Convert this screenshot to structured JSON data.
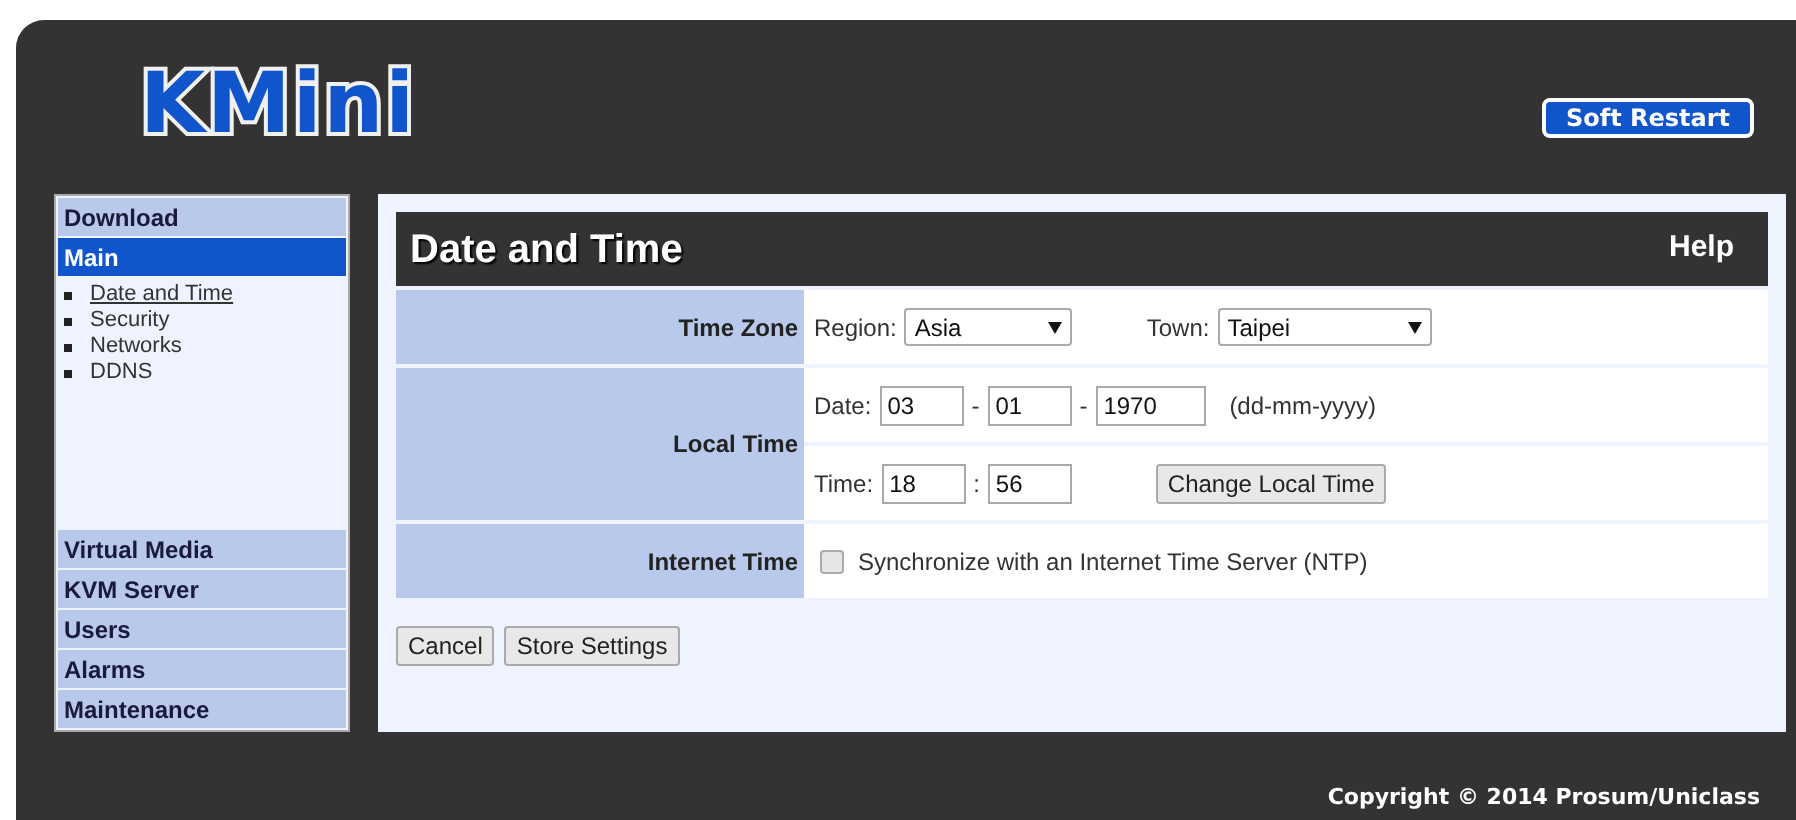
{
  "logo": "KMini",
  "soft_restart": "Soft Restart",
  "menu": [
    {
      "label": "Download",
      "selected": false
    },
    {
      "label": "Main",
      "selected": true,
      "children": [
        {
          "label": "Date and Time",
          "selected": true
        },
        {
          "label": "Security",
          "selected": false
        },
        {
          "label": "Networks",
          "selected": false
        },
        {
          "label": "DDNS",
          "selected": false
        }
      ]
    },
    {
      "label": "Virtual Media",
      "selected": false
    },
    {
      "label": "KVM Server",
      "selected": false
    },
    {
      "label": "Users",
      "selected": false
    },
    {
      "label": "Alarms",
      "selected": false
    },
    {
      "label": "Maintenance",
      "selected": false
    }
  ],
  "page": {
    "title": "Date and Time",
    "help": "Help"
  },
  "time_zone": {
    "label": "Time Zone",
    "region_label": "Region:",
    "region": "Asia",
    "town_label": "Town:",
    "town": "Taipei"
  },
  "local_time": {
    "label": "Local Time",
    "date_label": "Date:",
    "day": "03",
    "date_sep_1": "-",
    "month": "01",
    "date_sep_2": "-",
    "year": "1970",
    "format": "(dd-mm-yyyy)",
    "time_label": "Time:",
    "hour": "18",
    "time_sep": ":",
    "minute": "56",
    "change_button": "Change Local Time"
  },
  "internet_time": {
    "label": "Internet Time",
    "checked": false,
    "text": "Synchronize with an Internet Time Server (NTP)"
  },
  "buttons": [
    "Cancel",
    "Store Settings"
  ],
  "copyright": "Copyright © 2014 Prosum/Uniclass"
}
